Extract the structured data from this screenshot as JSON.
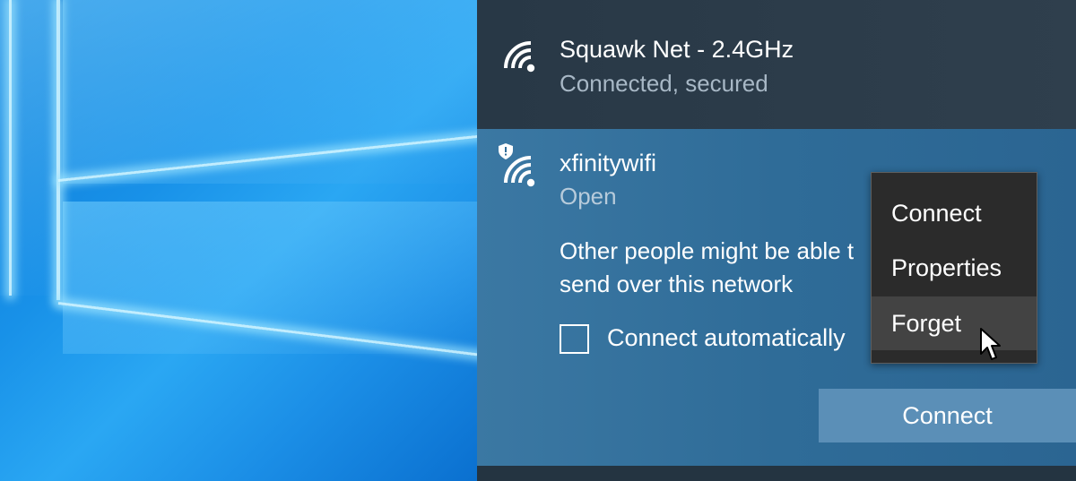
{
  "networks": [
    {
      "name": "Squawk Net - 2.4GHz",
      "status": "Connected, secured",
      "icon": "wifi-icon"
    },
    {
      "name": "xfinitywifi",
      "status": "Open",
      "icon": "wifi-shield-icon"
    }
  ],
  "selected_network": {
    "warning_line1": "Other people might be able t",
    "warning_line2": "send over this network",
    "auto_connect_label": "Connect automatically",
    "auto_connect_checked": false,
    "connect_button_label": "Connect"
  },
  "context_menu": {
    "items": [
      "Connect",
      "Properties",
      "Forget"
    ],
    "hovered": "Forget"
  },
  "colors": {
    "top_strip": "#2f3f4d",
    "selected_bg": "#336e9a",
    "menu_bg": "#2b2b2b",
    "menu_hover": "#434343",
    "button_bg": "#5b8fb7"
  }
}
